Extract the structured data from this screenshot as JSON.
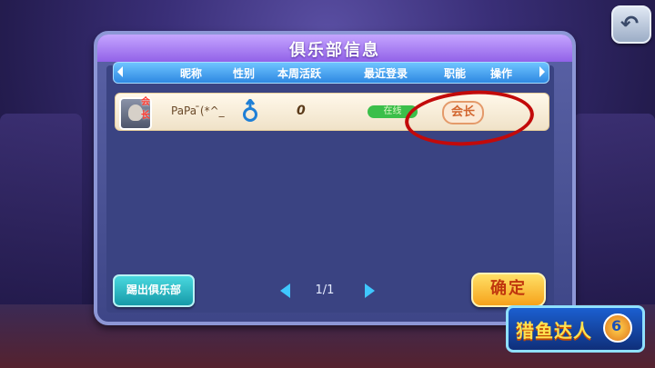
{
  "dialog": {
    "title": "俱乐部信息",
    "columns": [
      "昵称",
      "性别",
      "本周活跃",
      "最近登录",
      "职能",
      "操作"
    ]
  },
  "members": [
    {
      "badge": "会长",
      "nickname": "PaPa ̄(*^_",
      "gender": "male",
      "weekly_active": "0",
      "last_login": "在线",
      "role": "会长"
    }
  ],
  "buttons": {
    "kick": "踢出俱乐部",
    "confirm": "确定"
  },
  "pagination": {
    "text": "1/1"
  },
  "logo": {
    "text": "猎鱼达人"
  },
  "colors": {
    "annotation": "#c20a0a",
    "accent": "#3fc7ff"
  }
}
